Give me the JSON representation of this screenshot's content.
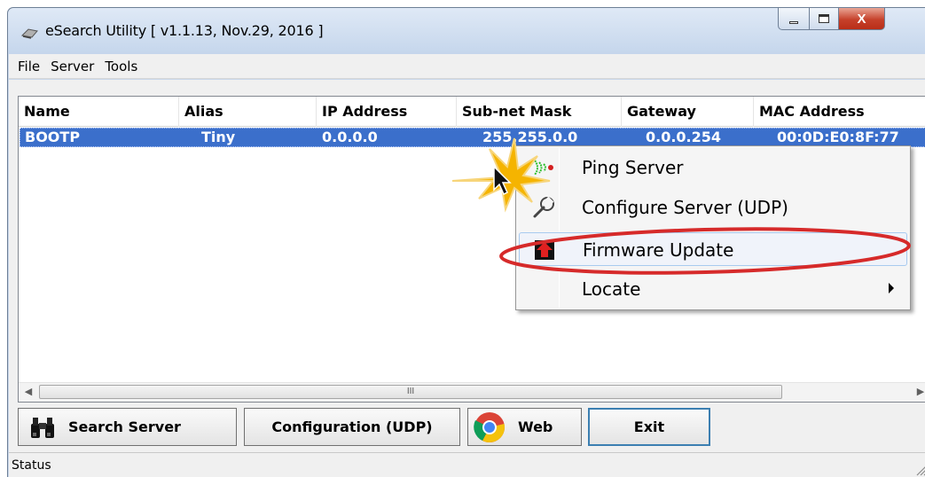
{
  "window": {
    "title": "eSearch Utility [ v1.1.13, Nov.29, 2016 ]",
    "close_glyph": "X"
  },
  "menubar": {
    "items": [
      "File",
      "Server",
      "Tools"
    ]
  },
  "listview": {
    "columns": [
      "Name",
      "Alias",
      "IP Address",
      "Sub-net Mask",
      "Gateway",
      "MAC Address"
    ],
    "rows": [
      {
        "name": "BOOTP",
        "alias": "Tiny",
        "ip": "0.0.0.0",
        "mask": "255.255.0.0",
        "gateway": "0.0.0.254",
        "mac": "00:0D:E0:8F:77"
      }
    ],
    "scroll_thumb_glyph": "III"
  },
  "context_menu": {
    "items": [
      {
        "label": "Ping Server",
        "icon": "ping-icon"
      },
      {
        "label": "Configure Server (UDP)",
        "icon": "wrench-icon"
      },
      {
        "label": "Firmware Update",
        "icon": "firmware-update-icon",
        "highlighted": true
      },
      {
        "label": "Locate",
        "icon": "",
        "has_submenu": true
      }
    ]
  },
  "buttons": {
    "search": "Search Server",
    "config": "Configuration (UDP)",
    "web": "Web",
    "exit": "Exit"
  },
  "status": {
    "text": "Status"
  },
  "colors": {
    "selection": "#3b6fcb",
    "highlight_ring": "#d62a2a",
    "cursor_burst": "#f5b400"
  }
}
